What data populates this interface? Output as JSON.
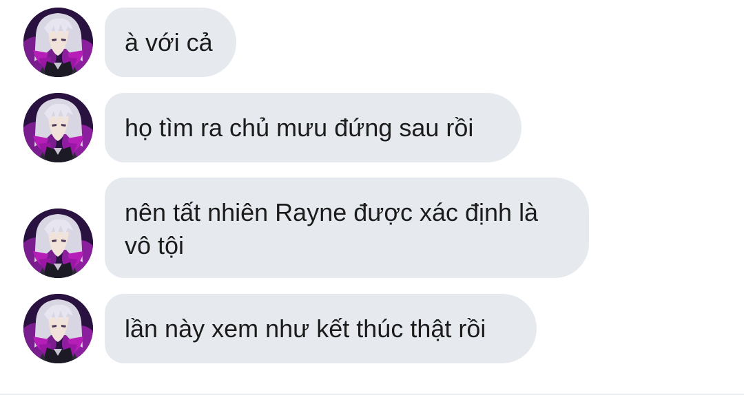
{
  "conversation": {
    "messages": [
      {
        "text": "à với cả"
      },
      {
        "text": "họ tìm ra chủ mưu đứng sau rồi"
      },
      {
        "text": "nên tất nhiên Rayne được xác định là vô tội"
      },
      {
        "text": "lần này xem như kết thúc thật rồi"
      }
    ],
    "avatar_icon": "anime-character-avatar-icon"
  },
  "colors": {
    "bubble_bg": "#e6eaef",
    "text": "#1c1c1c",
    "background": "#ffffff",
    "avatar_hair": "#d8d6e2",
    "avatar_purple": "#b51fb8"
  }
}
